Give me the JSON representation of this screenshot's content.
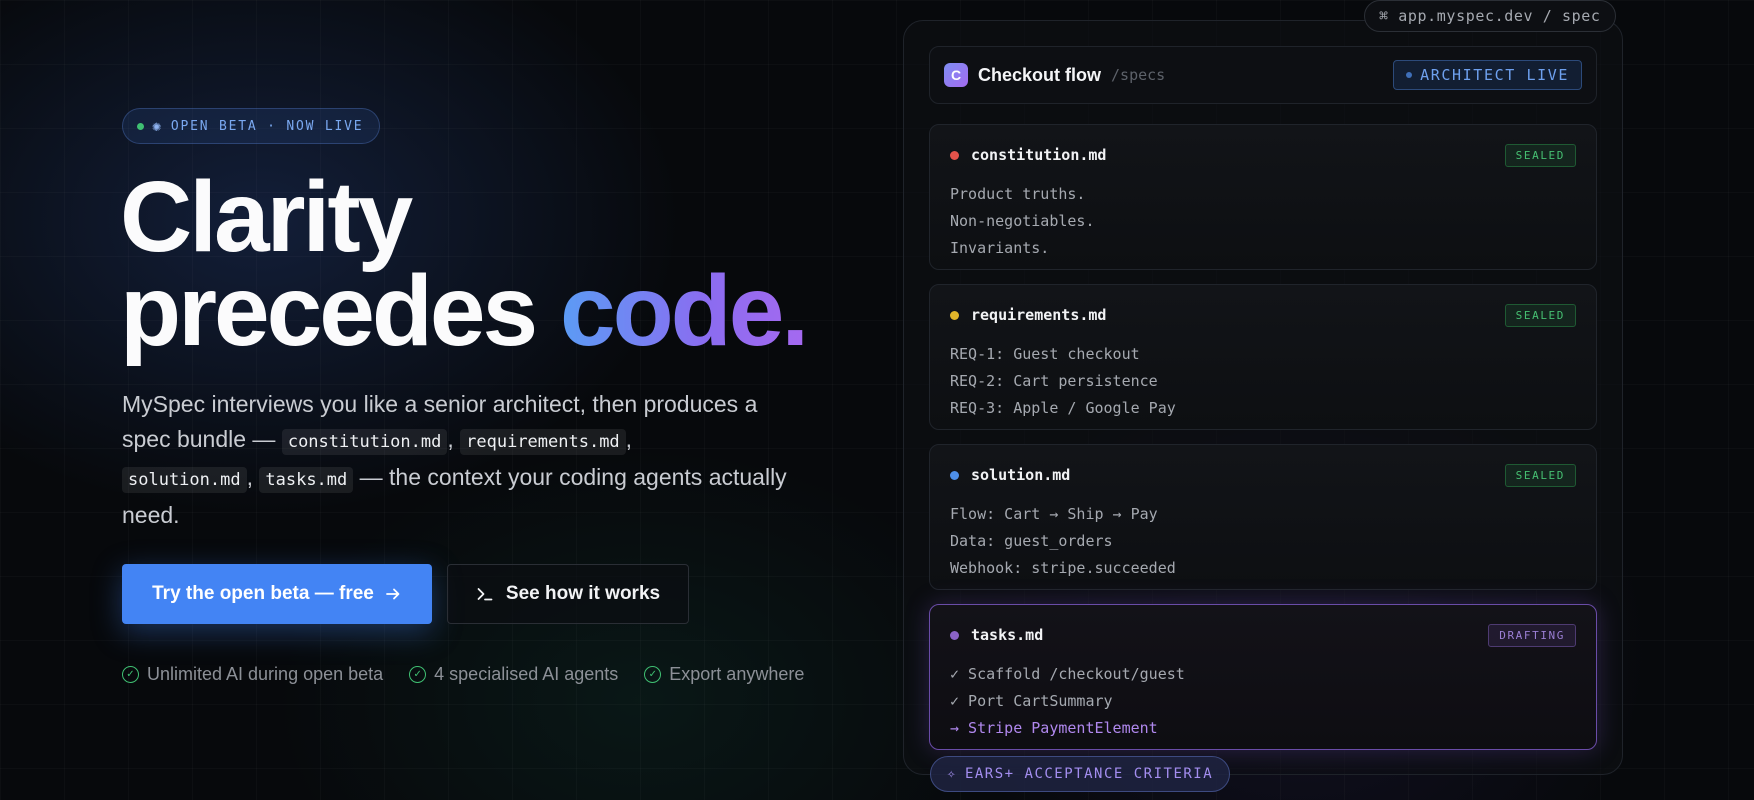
{
  "hero": {
    "badge": "OPEN BETA · NOW LIVE",
    "headline_line1": "Clarity",
    "headline_line2_plain": "precedes",
    "headline_line2_accent": "code.",
    "sub_part1": "MySpec interviews you like a senior architect, then produces a spec bundle —",
    "files": [
      "constitution.md",
      "requirements.md",
      "solution.md",
      "tasks.md"
    ],
    "sub_part2": "— the context your coding agents actually need.",
    "primary_cta": "Try the open beta — free",
    "secondary_cta": "See how it works",
    "checks": [
      "Unlimited AI during open beta",
      "4 specialised AI agents",
      "Export anywhere"
    ]
  },
  "preview": {
    "url": "app.myspec.dev / spec",
    "url_symbol": "⌘",
    "app_logo": "C",
    "app_title": "Checkout flow",
    "app_path": "/specs",
    "live_label": "ARCHITECT LIVE",
    "cards": [
      {
        "name": "constitution.md",
        "status": "SEALED",
        "dot": "#e5534b",
        "lines": [
          "Product truths.",
          "Non-negotiables.",
          "Invariants."
        ]
      },
      {
        "name": "requirements.md",
        "status": "SEALED",
        "dot": "#e3b62a",
        "lines": [
          "REQ-1: Guest checkout",
          "REQ-2: Cart persistence",
          "REQ-3: Apple / Google Pay"
        ]
      },
      {
        "name": "solution.md",
        "status": "SEALED",
        "dot": "#4e8fe8",
        "lines": [
          "Flow: Cart → Ship → Pay",
          "Data: guest_orders",
          "Webhook: stripe.succeeded"
        ]
      },
      {
        "name": "tasks.md",
        "status": "DRAFTING",
        "dot": "#8b63c7",
        "lines": [
          "✓ Scaffold /checkout/guest",
          "✓ Port CartSummary",
          "→ Stripe PaymentElement"
        ]
      }
    ],
    "criteria": "EARS+ ACCEPTANCE CRITERIA"
  },
  "colors": {
    "accent": "#4384f4",
    "success": "#3fbf72",
    "drafting": "#9b7fd4"
  }
}
